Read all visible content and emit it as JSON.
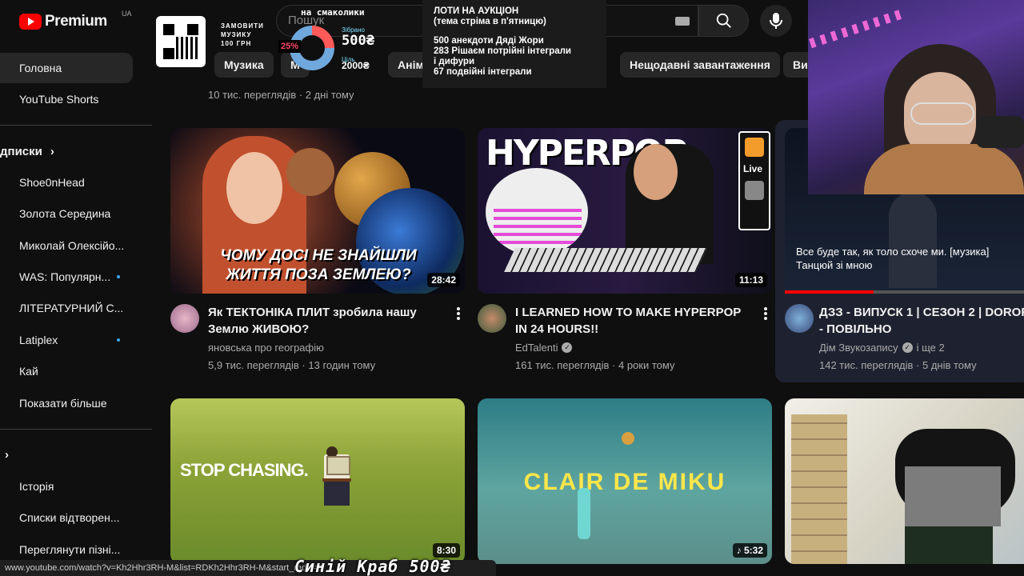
{
  "brand": {
    "logo_text": "Premium",
    "country": "UA"
  },
  "sidebar": {
    "main": [
      {
        "label": "Головна"
      },
      {
        "label": "YouTube Shorts"
      }
    ],
    "subscriptions_heading": "дписки",
    "subscriptions": [
      {
        "label": "Shoe0nHead"
      },
      {
        "label": "Золота Середина"
      },
      {
        "label": "Миколай Олексійо..."
      },
      {
        "label": "WAS: Популярн..."
      },
      {
        "label": "ЛІТЕРАТУРНИЙ С..."
      },
      {
        "label": "Latiplex"
      },
      {
        "label": "Кай"
      },
      {
        "label": "Показати більше"
      }
    ],
    "you": [
      {
        "label": "Історія"
      },
      {
        "label": "Списки відтворен..."
      },
      {
        "label": "Переглянути пізні..."
      }
    ]
  },
  "search": {
    "placeholder": "Пошук"
  },
  "stream_overlay": {
    "qr_caption": [
      "ЗАМОВИТИ",
      "МУЗИКУ",
      "100 ГРН"
    ],
    "fundraiser_title": "на смаколики",
    "collected_label": "Зібрано",
    "collected_value": "500₴",
    "goal_label": "Ціль",
    "goal_value": "2000₴",
    "percent": "25%",
    "percent_value": 25,
    "auction_title": "ЛОТИ НА АУКЦІОН",
    "auction_subtitle": "(тема стріма в п'ятницю)",
    "auction_items": [
      "500 анекдоти Дяді Жори",
      "283 Рішаєм потрійні інтеграли",
      "і дифури",
      "67 подвійні інтеграли"
    ],
    "donation_ticker": "Синій Краб 500₴"
  },
  "chips": [
    "Музика",
    "М",
    "Аніме",
    "Нещодавні завантаження",
    "Ви"
  ],
  "prev_row_meta": "10 тис. переглядів · 2 дні тому",
  "videos": [
    {
      "title": "Як ТЕКТОНІКА ПЛИТ зробила нашу Землю ЖИВОЮ?",
      "channel": "яновська про географію",
      "stats": "5,9 тис. переглядів · 13 годин тому",
      "duration": "28:42",
      "thumb_text": "ЧОМУ ДОСІ НЕ ЗНАЙШЛИ ЖИТТЯ ПОЗА ЗЕМЛЕЮ?"
    },
    {
      "title": "I LEARNED HOW TO MAKE HYPERPOP IN 24 HOURS!!",
      "channel": "EdTalenti",
      "stats": "161 тис. переглядів · 4 роки тому",
      "duration": "11:13",
      "thumb_text": "HYPERPOP",
      "thumb_side": "Live"
    },
    {
      "title": "ДЗЗ - ВИПУСК 1 | СЕЗОН 2 | DOROF - ПОВІЛЬНО",
      "channel": "Дім Звукозапису",
      "channel_extra": "і ще 2",
      "stats": "142 тис. переглядів · 5 днів тому",
      "caption": "Все буде так, як толо схоче ми. [музика] Танцюй зі мною"
    },
    {
      "duration": "8:30",
      "thumb_text": "STOP CHASING."
    },
    {
      "duration": "5:32",
      "thumb_text": "CLAIR DE MIKU"
    },
    {}
  ],
  "status_url": "www.youtube.com/watch?v=Kh2Hhr3RH-M&list=RDKh2Hhr3RH-M&start_radio=1"
}
